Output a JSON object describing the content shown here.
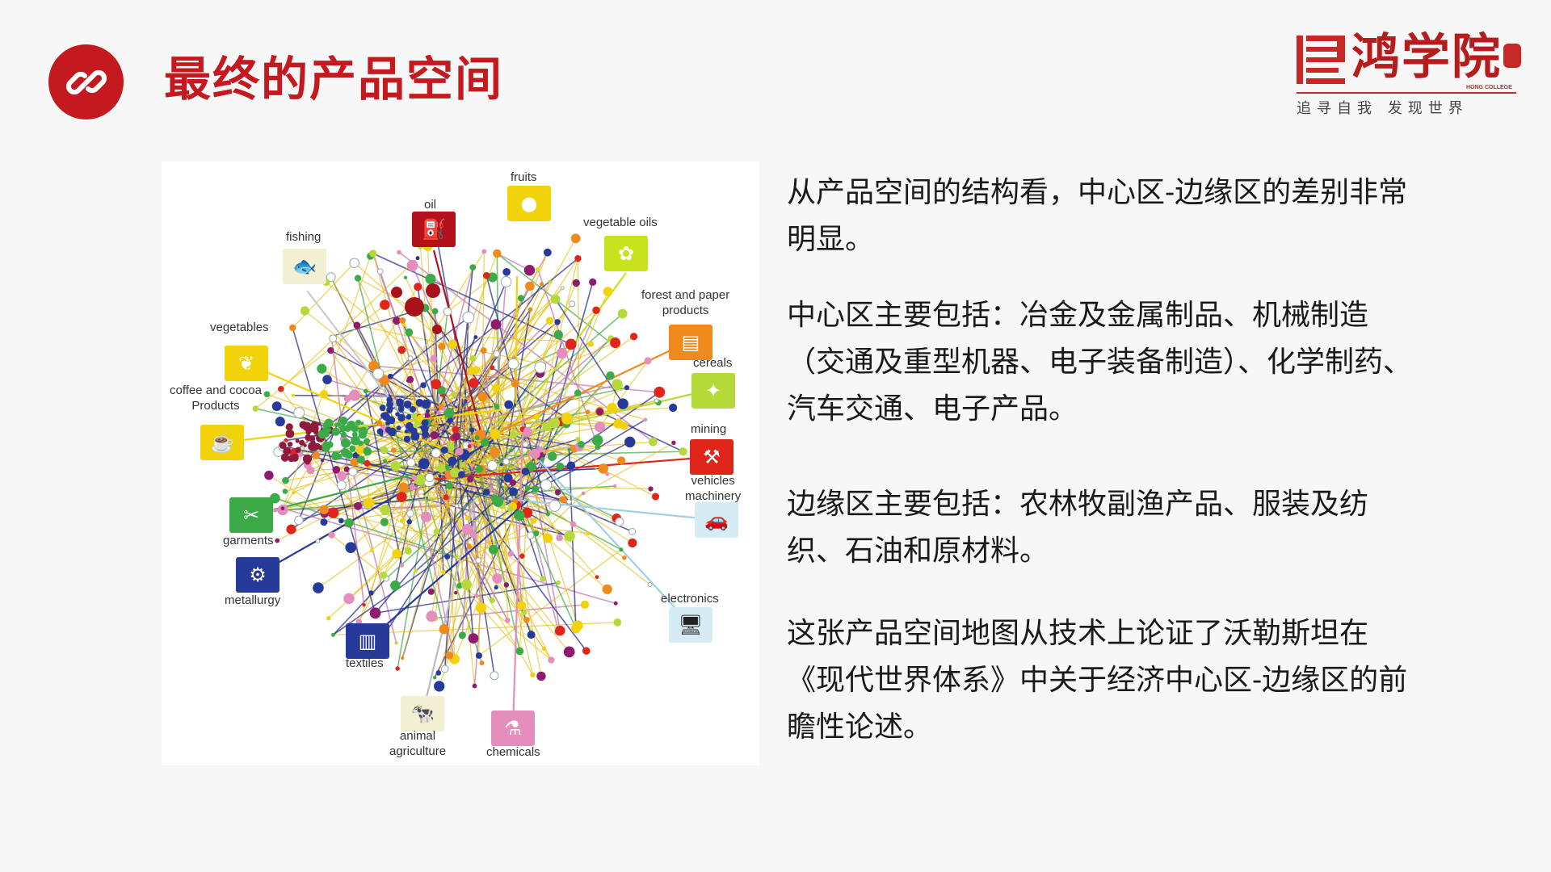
{
  "header": {
    "title": "最终的产品空间",
    "icon": "link-icon",
    "accent_color": "#c41a1f"
  },
  "logo": {
    "name": "鸿学院",
    "english": "HONG COLLEGE",
    "slogan": "追寻自我  发现世界"
  },
  "figure": {
    "labels": {
      "fruits": "fruits",
      "oil": "oil",
      "fishing": "fishing",
      "vegetable_oils": "vegetable oils",
      "forest_paper": "forest and paper\nproducts",
      "vegetables": "vegetables",
      "cereals": "cereals",
      "coffee_cocoa": "coffee and cocoa\nProducts",
      "mining": "mining",
      "vehicles": "vehicles\nmachinery",
      "garments": "garments",
      "metallurgy": "metallurgy",
      "electronics": "electronics",
      "textiles": "textiles",
      "animal_agriculture": "animal\nagriculture",
      "chemicals": "chemicals"
    }
  },
  "paragraphs": [
    "从产品空间的结构看，中心区-边缘区的差别非常明显。",
    "中心区主要包括：冶金及金属制品、机械制造（交通及重型机器、电子装备制造）、化学制药、汽车交通、电子产品。",
    "边缘区主要包括：农林牧副渔产品、服装及纺织、石油和原材料。",
    "这张产品空间地图从技术上论证了沃勒斯坦在《现代世界体系》中关于经济中心区-边缘区的前瞻性论述。"
  ]
}
